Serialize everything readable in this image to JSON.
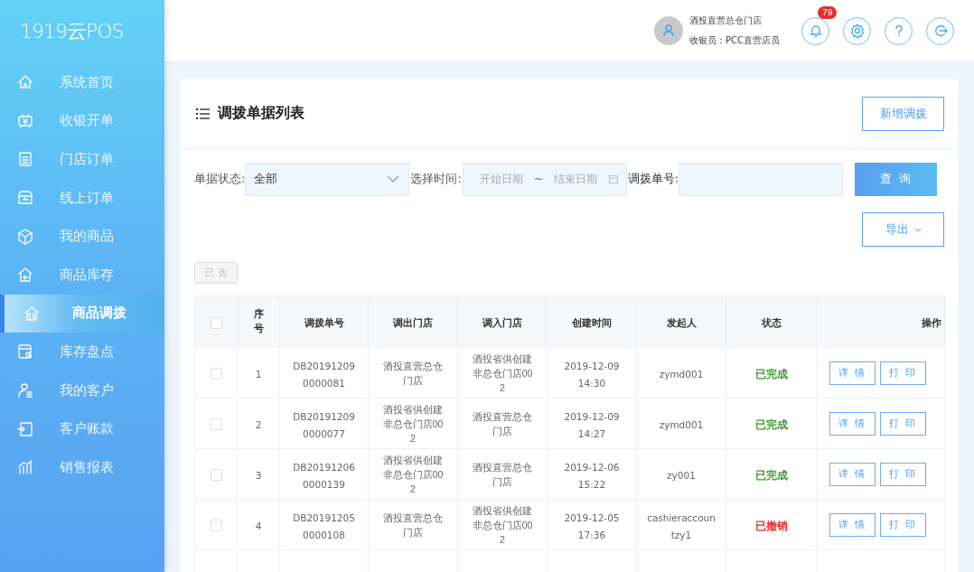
{
  "logo": "1919云POS",
  "sidebar": {
    "items": [
      {
        "label": "系统首页",
        "selected": false
      },
      {
        "label": "收银开单",
        "selected": false
      },
      {
        "label": "门店订单",
        "selected": false
      },
      {
        "label": "线上订单",
        "selected": false
      },
      {
        "label": "我的商品",
        "selected": false
      },
      {
        "label": "商品库存",
        "selected": false
      },
      {
        "label": "商品调拨",
        "selected": true
      },
      {
        "label": "库存盘点",
        "selected": false
      },
      {
        "label": "我的客户",
        "selected": false
      },
      {
        "label": "客户账款",
        "selected": false
      },
      {
        "label": "销售报表",
        "selected": false
      }
    ]
  },
  "header": {
    "store": "酒投直营总仓门店",
    "cashier": "收银员：PCC直营店员",
    "notifications": "79"
  },
  "page_title": "调拨单据列表",
  "add_button": "新增调拨",
  "filters": {
    "status_label": "单据状态:",
    "status_value": "全部",
    "time_label": "选择时间:",
    "start_placeholder": "开始日期",
    "separator": "~",
    "end_placeholder": "结束日期",
    "number_label": "调拨单号:",
    "query_button": "查 询"
  },
  "export_button": "导出",
  "selected_button": "已 选",
  "table": {
    "all_checked": false,
    "columns": [
      "序号",
      "调拨单号",
      "调出门店",
      "调入门店",
      "创建时间",
      "发起人",
      "状态",
      "操作"
    ],
    "rows": [
      {
        "checked": false,
        "index": "1",
        "number": "DB20191209\n0000081",
        "from": "酒投直营总仓门店",
        "to": "酒投省供创建非总仓门店002",
        "created": "2019-12-09\n14:30",
        "creator": "zymd001",
        "status": "已完成",
        "color": "#3d9a2e",
        "actions": [
          "详 情",
          "打 印"
        ]
      },
      {
        "checked": false,
        "index": "2",
        "number": "DB20191209\n0000077",
        "from": "酒投省供创建非总仓门店002",
        "to": "酒投直营总仓门店",
        "created": "2019-12-09\n14:27",
        "creator": "zymd001",
        "status": "已完成",
        "color": "#3d9a2e",
        "actions": [
          "详 情",
          "打 印"
        ]
      },
      {
        "checked": false,
        "index": "3",
        "number": "DB20191206\n0000139",
        "from": "酒投省供创建非总仓门店002",
        "to": "酒投直营总仓门店",
        "created": "2019-12-06\n15:22",
        "creator": "zy001",
        "status": "已完成",
        "color": "#3d9a2e",
        "actions": [
          "详 情",
          "打 印"
        ]
      },
      {
        "checked": false,
        "index": "4",
        "number": "DB20191205\n0000108",
        "from": "酒投直营总仓门店",
        "to": "酒投省供创建非总仓门店002",
        "created": "2019-12-05\n17:36",
        "creator": "cashieraccoun\ntzy1",
        "status": "已撤销",
        "color": "#e2302f",
        "actions": [
          "详 情",
          "打 印"
        ]
      }
    ]
  }
}
